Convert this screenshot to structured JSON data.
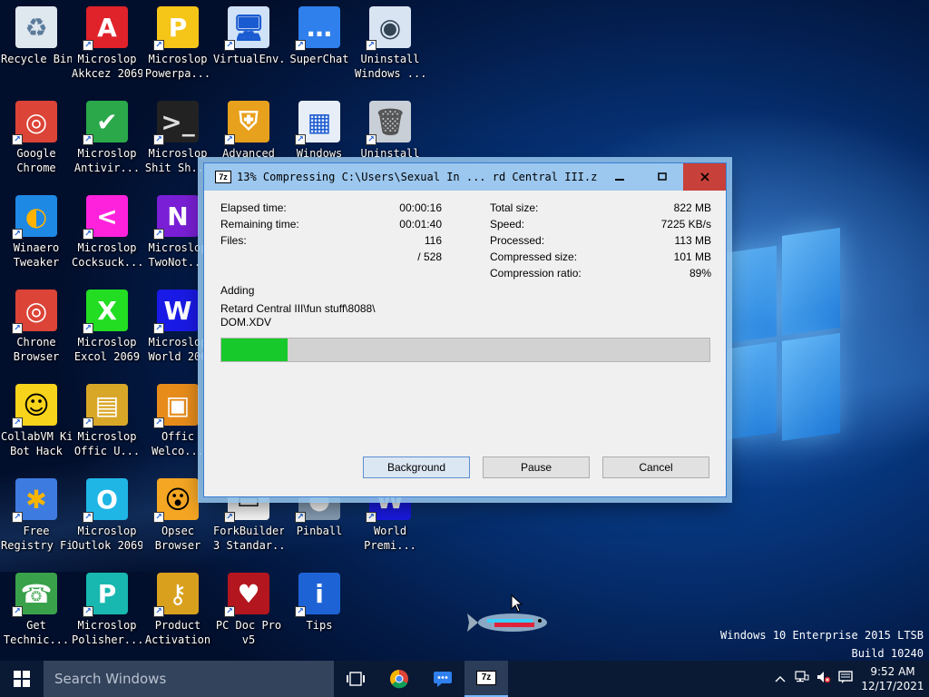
{
  "desktop_icons": [
    {
      "label": "Recycle Bin",
      "icon": "recycle-bin-icon"
    },
    {
      "label": "Microslop\nAkkcez 2069",
      "icon": "access-icon"
    },
    {
      "label": "Microslop\nPowerpa...",
      "icon": "powerpoint-icon"
    },
    {
      "label": "VirtualEnv...",
      "icon": "computer-icon"
    },
    {
      "label": "SuperChat",
      "icon": "chat-icon"
    },
    {
      "label": "Uninstall\nWindows ...",
      "icon": "uninstall-disc-icon"
    },
    {
      "label": "Google\nChrome",
      "icon": "chrome-icon"
    },
    {
      "label": "Microslop\nAntivir...",
      "icon": "shield-check-icon"
    },
    {
      "label": "Microslop\nShit Sh...",
      "icon": "terminal-icon"
    },
    {
      "label": "Advanced",
      "icon": "security-shield-icon"
    },
    {
      "label": "Windows",
      "icon": "window-icon"
    },
    {
      "label": "Uninstall",
      "icon": "trash-can-icon"
    },
    {
      "label": "Winaero\nTweaker",
      "icon": "winaero-icon"
    },
    {
      "label": "Microslop\nCocksuck...",
      "icon": "magenta-app-icon"
    },
    {
      "label": "Microslop\nTwoNot...",
      "icon": "onenote-icon"
    },
    {
      "label": "Chrone\nBrowser",
      "icon": "chrome-icon"
    },
    {
      "label": "Microslop\nExcol 2069",
      "icon": "excel-icon"
    },
    {
      "label": "Microslop\nWorld 206",
      "icon": "word-icon"
    },
    {
      "label": "CollabVM Kit\nBot Hack",
      "icon": "smiley-icon"
    },
    {
      "label": "Microslop\nOffic U...",
      "icon": "office-update-icon"
    },
    {
      "label": "Offic\nWelco...",
      "icon": "office-logo-icon"
    },
    {
      "label": "Free\nRegistry Fix",
      "icon": "registry-icon"
    },
    {
      "label": "Microslop\nOutlok 2069",
      "icon": "outlook-icon"
    },
    {
      "label": "Opsec\nBrowser",
      "icon": "surprised-face-icon"
    },
    {
      "label": "ForkBuilder\n3 Standar...",
      "icon": "monitor-icon"
    },
    {
      "label": "Pinball",
      "icon": "pinball-icon"
    },
    {
      "label": "World\nPremi...",
      "icon": "word-icon"
    },
    {
      "label": "Get\nTechnic...",
      "icon": "support-agent-icon"
    },
    {
      "label": "Microslop\nPolisher...",
      "icon": "publisher-icon"
    },
    {
      "label": "Product\nActivation",
      "icon": "key-icon"
    },
    {
      "label": "PC Doc Pro\nv5",
      "icon": "pc-doc-icon"
    },
    {
      "label": "Tips",
      "icon": "info-icon"
    }
  ],
  "dialog": {
    "app_icon": "7z",
    "title": "13% Compressing C:\\Users\\Sexual In ... rd Central III.zip",
    "left_stats": [
      {
        "label": "Elapsed time:",
        "value": "00:00:16"
      },
      {
        "label": "Remaining time:",
        "value": "00:01:40"
      },
      {
        "label": "Files:",
        "value": "116"
      },
      {
        "label": "",
        "value": "/ 528"
      }
    ],
    "right_stats": [
      {
        "label": "Total size:",
        "value": "822 MB"
      },
      {
        "label": "Speed:",
        "value": "7225 KB/s"
      },
      {
        "label": "Processed:",
        "value": "113 MB"
      },
      {
        "label": "Compressed size:",
        "value": "101 MB"
      },
      {
        "label": "Compression ratio:",
        "value": "89%"
      }
    ],
    "status": "Adding",
    "current_file": "Retard Central III\\fun stuff\\8088\\\nDOM.XDV",
    "progress": 0.135,
    "buttons": {
      "background": "Background",
      "pause": "Pause",
      "cancel": "Cancel"
    }
  },
  "watermark": {
    "line1": "Windows 10 Enterprise 2015 LTSB",
    "line2": "Build 10240"
  },
  "taskbar": {
    "search_placeholder": "Search Windows",
    "active_app": "7z",
    "clock_time": "9:52 AM",
    "clock_date": "12/17/2021"
  },
  "colors": {
    "accent": "#9cc7ee",
    "progress": "#18c92c",
    "close": "#c7413a",
    "taskbar": "#0a1a35"
  }
}
